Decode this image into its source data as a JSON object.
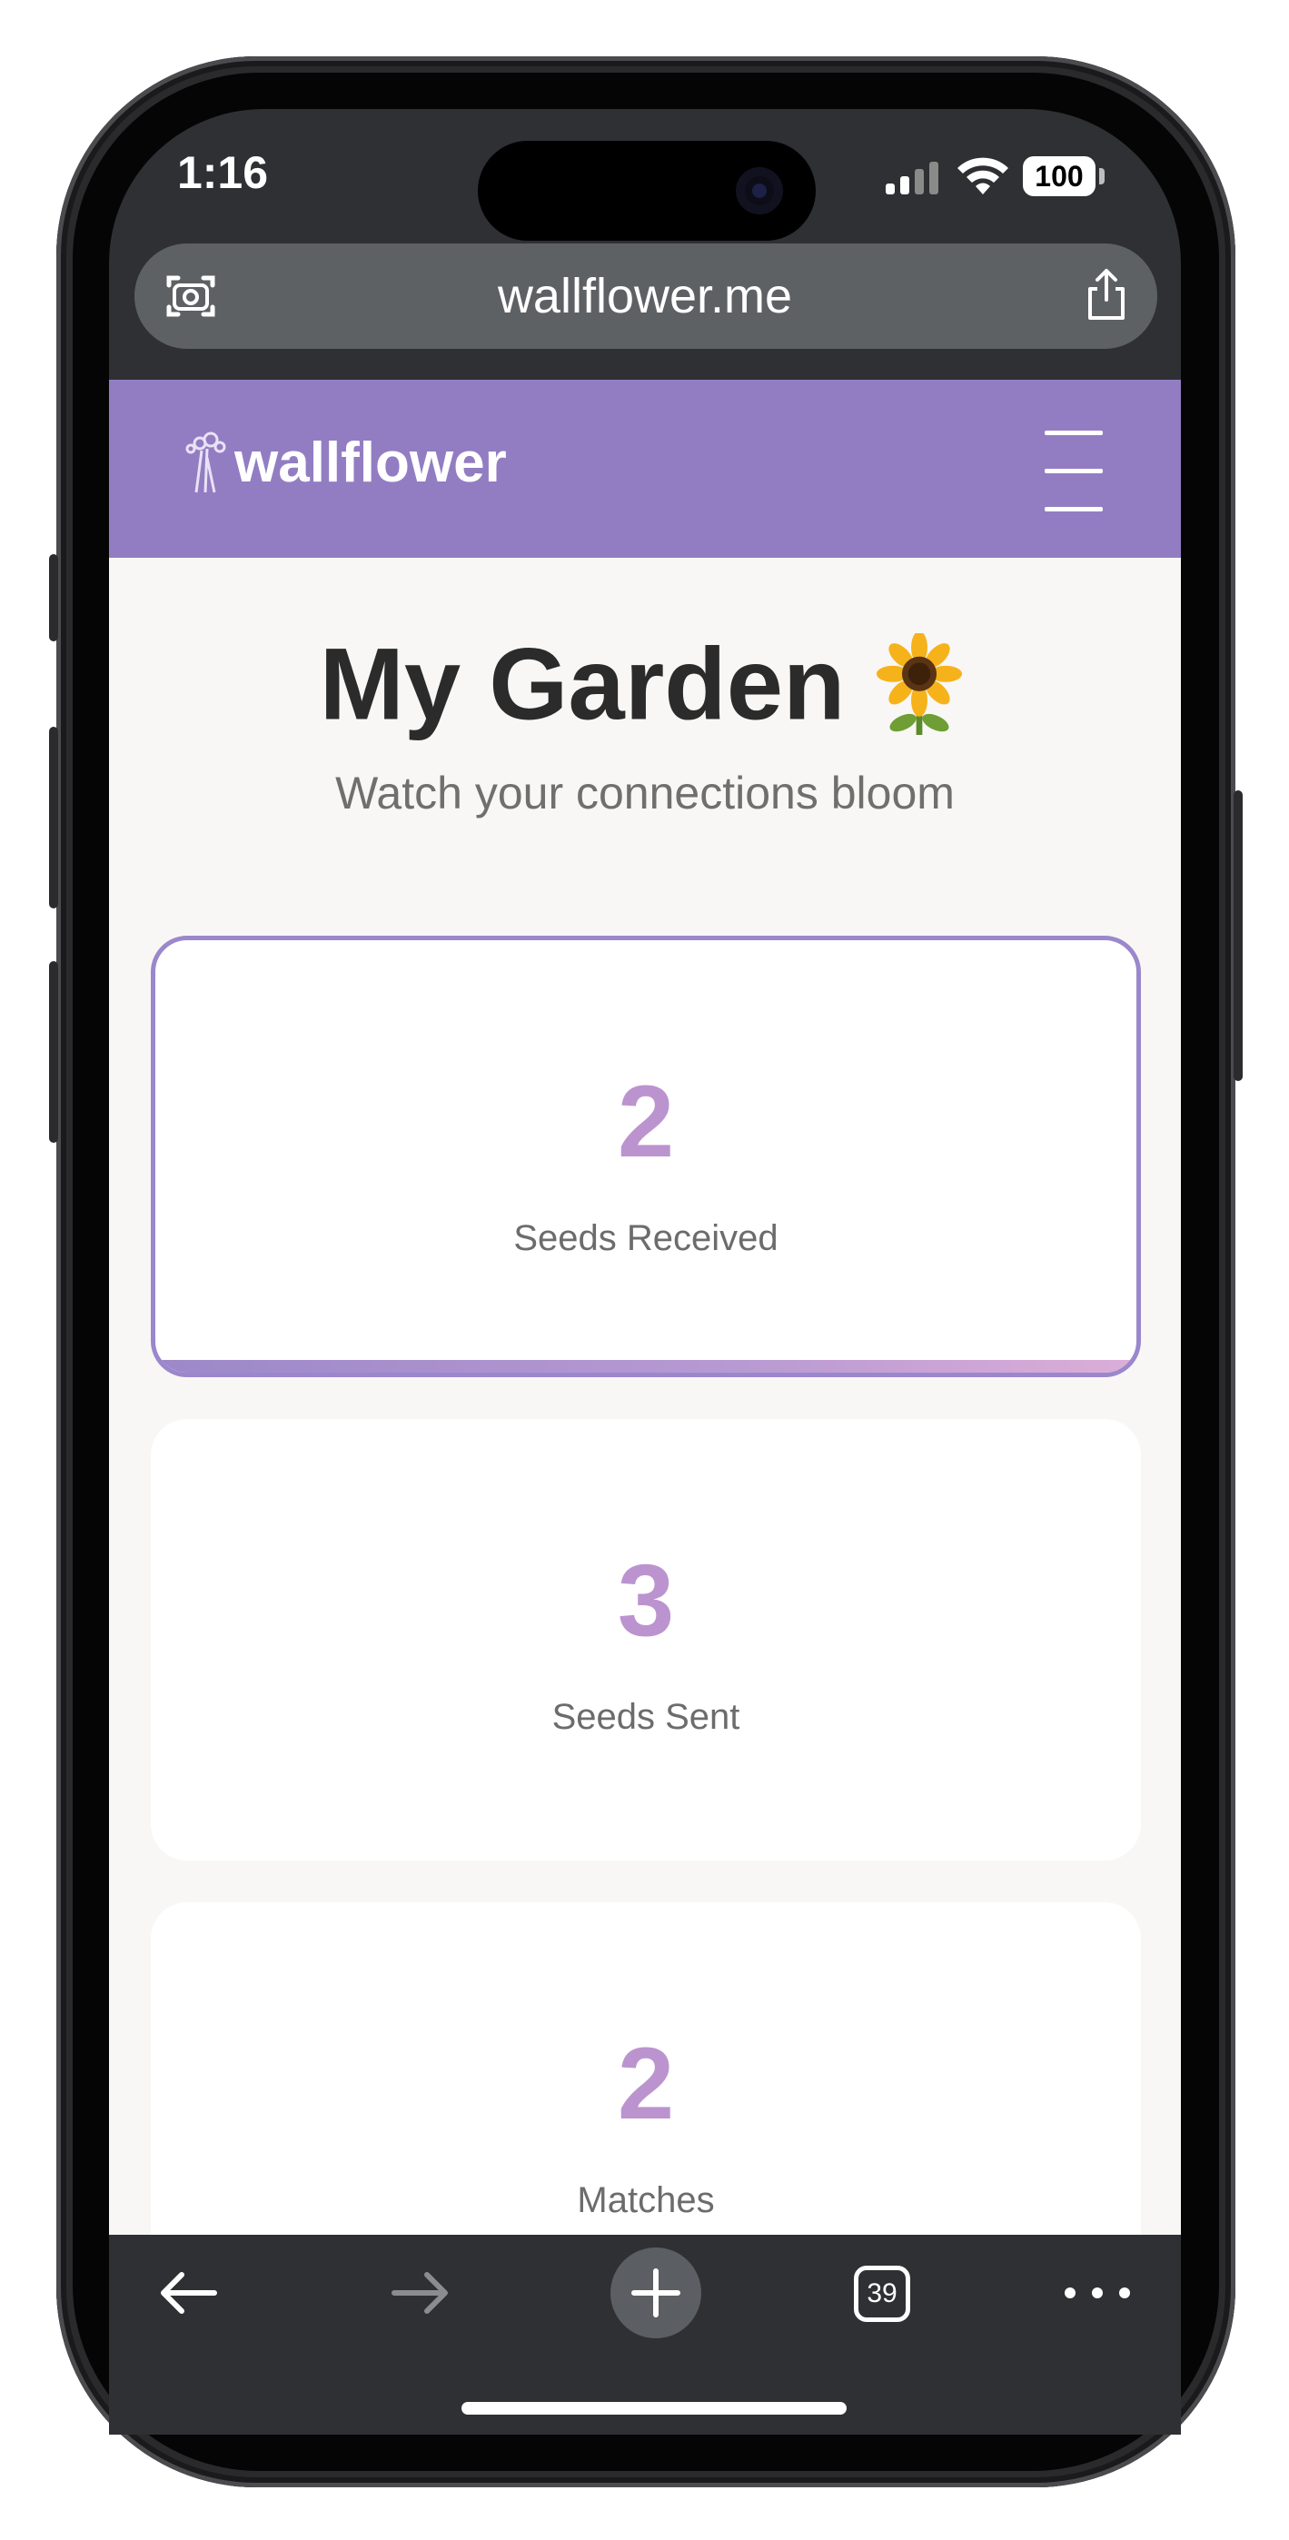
{
  "status_bar": {
    "time": "1:16",
    "battery": "100"
  },
  "browser": {
    "url": "wallflower.me",
    "tabs_count": "39"
  },
  "nav": {
    "brand": "wallflower",
    "menu_icon": "hamburger-menu-icon"
  },
  "header": {
    "title": "My Garden",
    "title_emoji_icon": "sunflower-icon",
    "subtitle": "Watch your connections bloom"
  },
  "stats": [
    {
      "value": "2",
      "label": "Seeds Received",
      "active": true
    },
    {
      "value": "3",
      "label": "Seeds Sent",
      "active": false
    },
    {
      "value": "2",
      "label": "Matches",
      "active": false
    }
  ],
  "colors": {
    "brand_purple": "#927dc3",
    "stat_value": "#bb94cf",
    "active_border": "#9b87cc",
    "page_background": "#f8f7f5",
    "browser_chrome": "#2e3033"
  }
}
